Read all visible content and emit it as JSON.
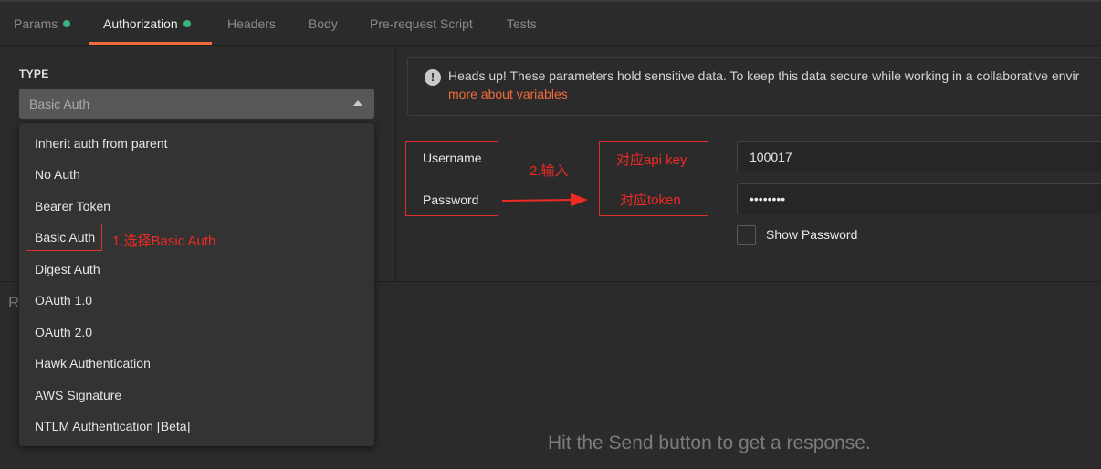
{
  "tabs": [
    {
      "label": "Params",
      "dot": true
    },
    {
      "label": "Authorization",
      "dot": true
    },
    {
      "label": "Headers",
      "dot": false
    },
    {
      "label": "Body",
      "dot": false
    },
    {
      "label": "Pre-request Script",
      "dot": false
    },
    {
      "label": "Tests",
      "dot": false
    }
  ],
  "auth": {
    "type_label": "TYPE",
    "selected": "Basic Auth",
    "options": [
      "Inherit auth from parent",
      "No Auth",
      "Bearer Token",
      "Basic Auth",
      "Digest Auth",
      "OAuth 1.0",
      "OAuth 2.0",
      "Hawk Authentication",
      "AWS Signature",
      "NTLM Authentication [Beta]"
    ]
  },
  "alert": {
    "text": "Heads up! These parameters hold sensitive data. To keep this data secure while working in a collaborative envir",
    "link": "more about variables"
  },
  "fields": {
    "username_label": "Username",
    "password_label": "Password",
    "username_value": "100017",
    "password_value": "••••••••",
    "show_password_label": "Show Password"
  },
  "annotations": {
    "step1": "1.选择Basic Auth",
    "step2": "2.输入",
    "api_key": "对应api key",
    "token": "对应token"
  },
  "response": {
    "bar_letter": "R",
    "hint": "Hit the Send button to get a response."
  },
  "colors": {
    "accent": "#f26b3a",
    "dot": "#3bb57e",
    "annotation": "#e0302b"
  }
}
